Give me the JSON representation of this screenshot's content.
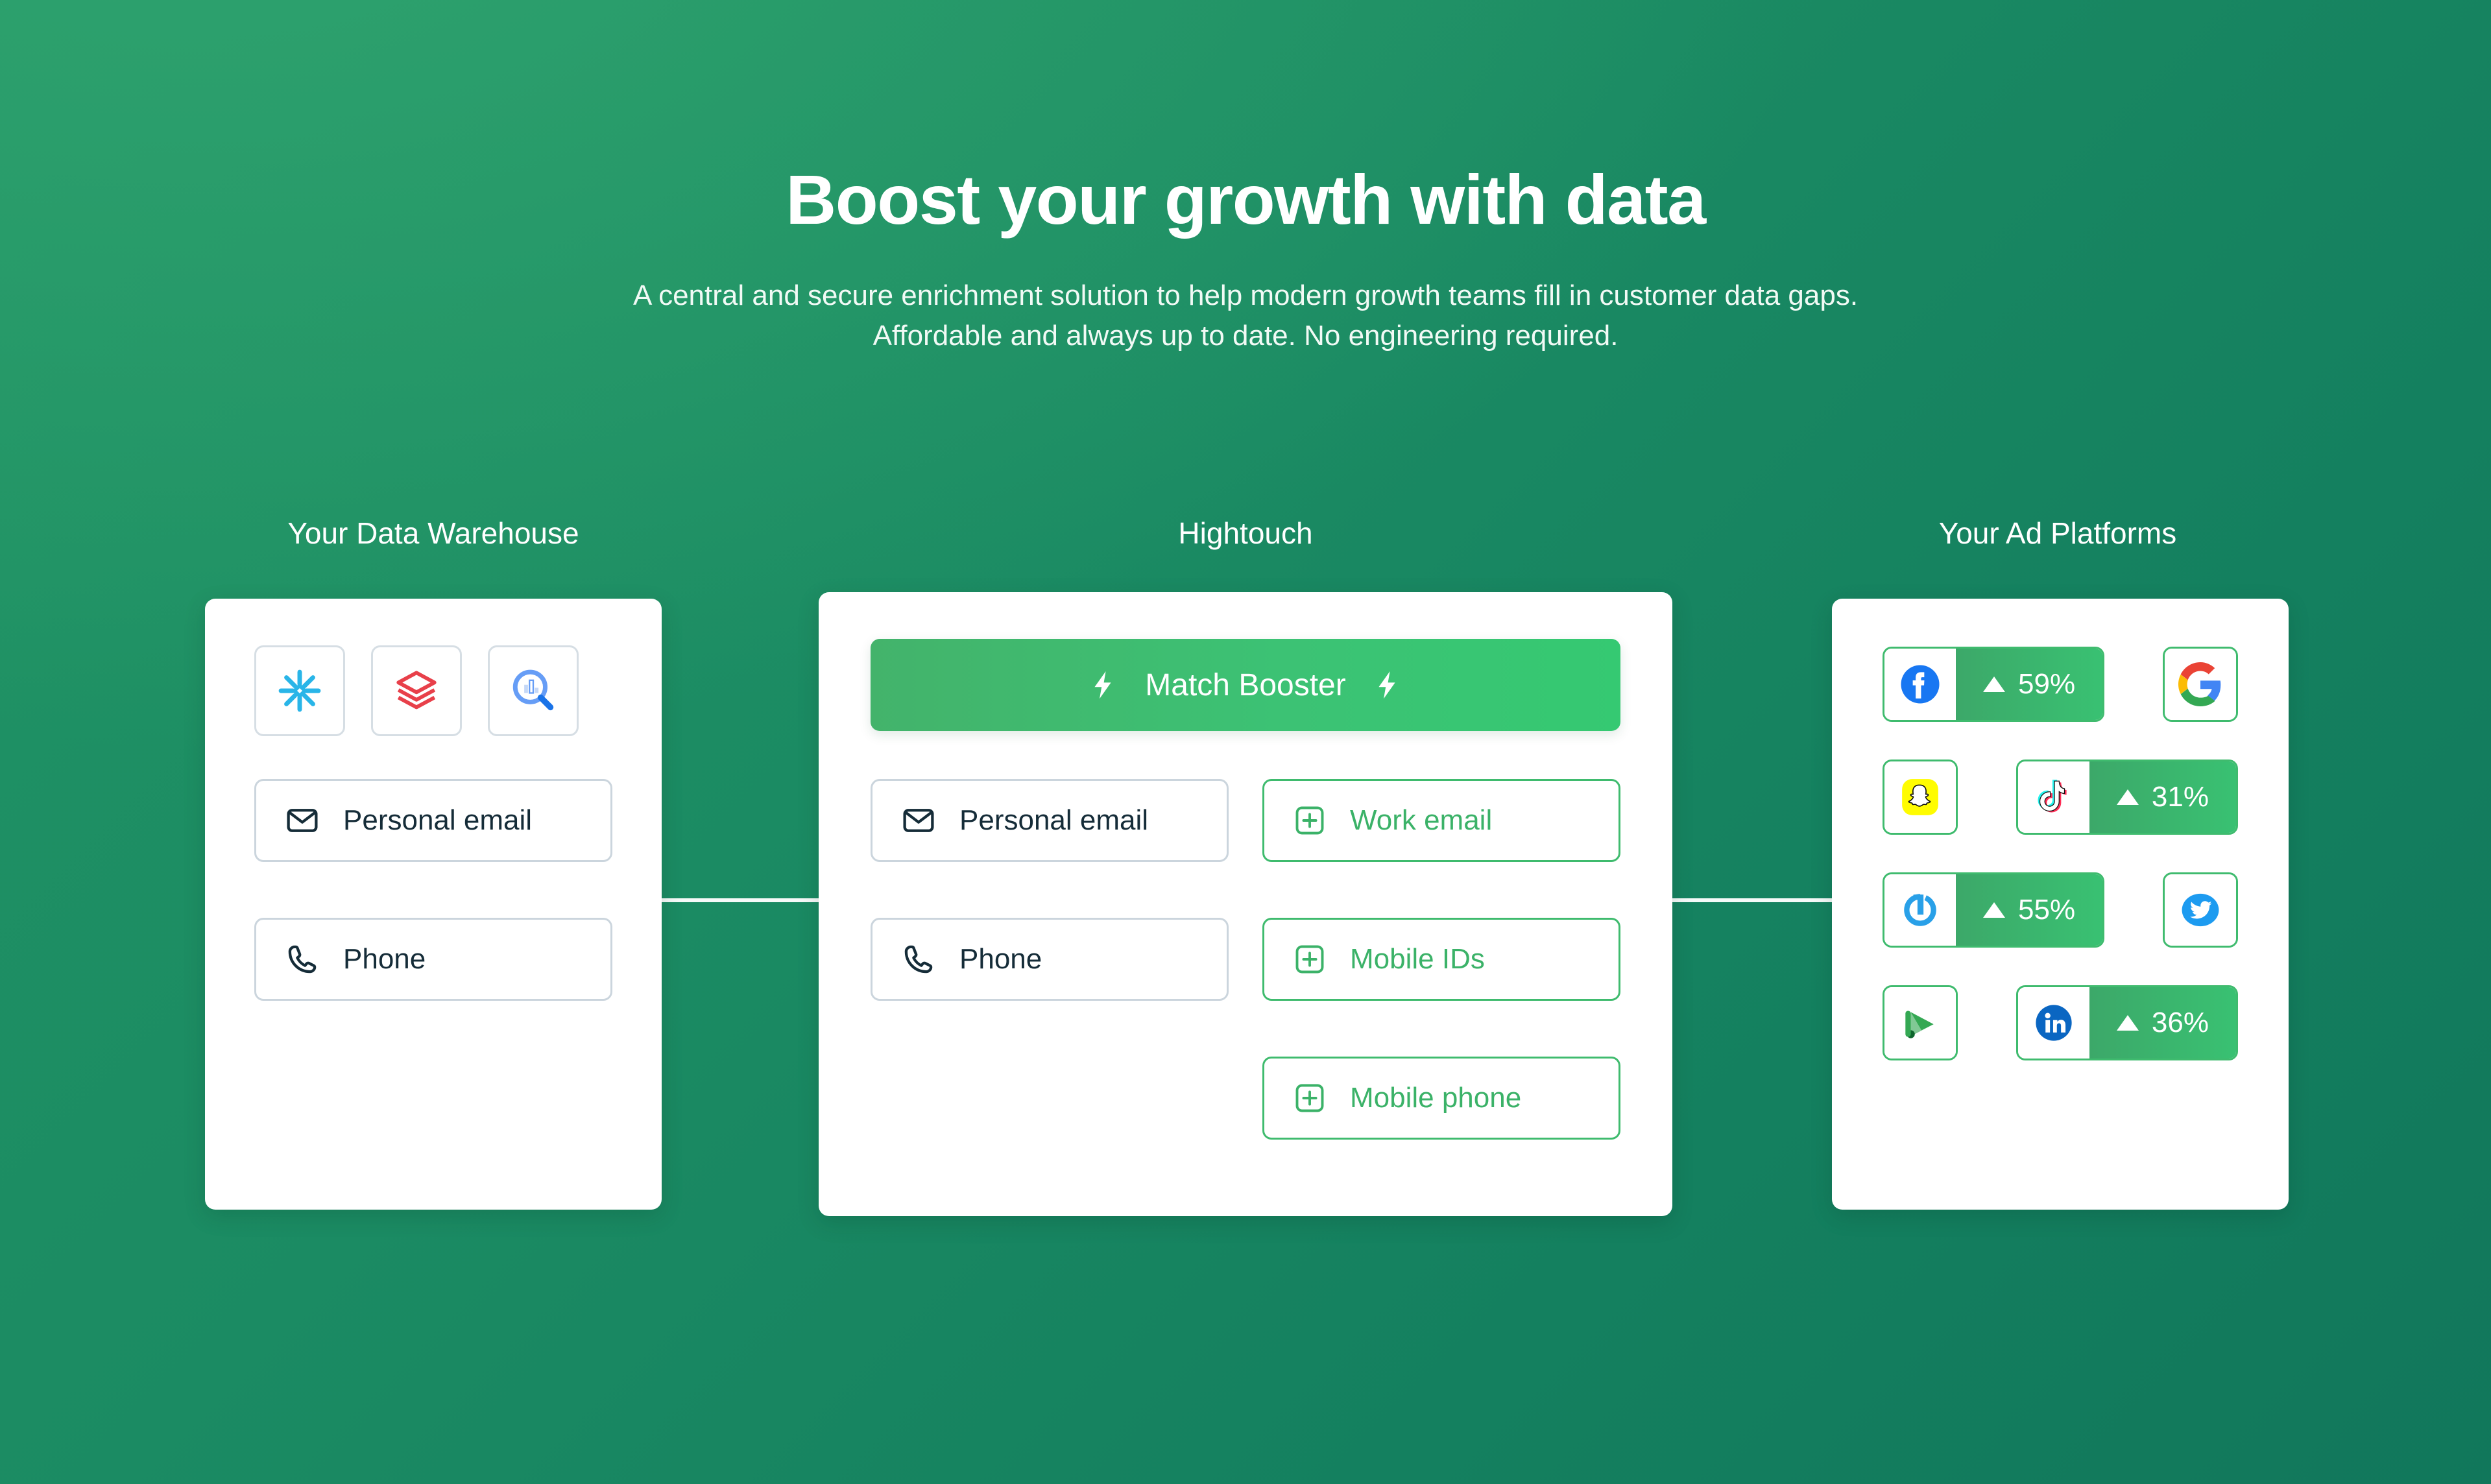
{
  "hero": {
    "title": "Boost your growth with data",
    "subtitle_line1": "A central and secure enrichment solution to help modern growth teams fill in customer data gaps.",
    "subtitle_line2": "Affordable and always up to date. No engineering required."
  },
  "colors": {
    "background_start": "#219464",
    "background_end": "#11775B",
    "accent_green": "#3FBB6E",
    "booster_gradient_start": "#43B36B",
    "booster_gradient_end": "#35C972",
    "field_border_grey": "#CBD5DD",
    "text_dark": "#152C38",
    "white": "#FFFFFF"
  },
  "columns": {
    "warehouse_label": "Your Data Warehouse",
    "hightouch_label": "Hightouch",
    "adplatforms_label": "Your Ad Platforms"
  },
  "warehouse": {
    "logos": [
      {
        "name": "snowflake-logo",
        "title": "Snowflake"
      },
      {
        "name": "databricks-logo",
        "title": "Databricks"
      },
      {
        "name": "bigquery-logo",
        "title": "BigQuery"
      }
    ],
    "fields": [
      {
        "icon": "envelope-icon",
        "label": "Personal email"
      },
      {
        "icon": "phone-icon",
        "label": "Phone"
      }
    ]
  },
  "hightouch": {
    "booster_label": "Match Booster",
    "booster_icon_left": "lightning-bolt-icon",
    "booster_icon_right": "lightning-bolt-icon",
    "existing_fields": [
      {
        "icon": "envelope-icon",
        "label": "Personal email"
      },
      {
        "icon": "phone-icon",
        "label": "Phone"
      }
    ],
    "enriched_fields": [
      {
        "icon": "plus-square-icon",
        "label": "Work email"
      },
      {
        "icon": "plus-square-icon",
        "label": "Mobile IDs"
      },
      {
        "icon": "plus-square-icon",
        "label": "Mobile phone"
      }
    ]
  },
  "ad_platforms": {
    "rows": [
      {
        "align": "left",
        "platform": "facebook-logo",
        "platform_title": "Facebook",
        "has_stat": true,
        "stat": "59%",
        "trend": "up"
      },
      {
        "align": "right",
        "platform": "google-logo",
        "platform_title": "Google",
        "has_stat": false,
        "stat": "",
        "trend": ""
      },
      {
        "align": "left",
        "platform": "snapchat-logo",
        "platform_title": "Snapchat",
        "has_stat": false,
        "stat": "",
        "trend": ""
      },
      {
        "align": "right",
        "platform": "tiktok-logo",
        "platform_title": "TikTok",
        "has_stat": true,
        "stat": "31%",
        "trend": "up"
      },
      {
        "align": "left",
        "platform": "tradedesk-logo",
        "platform_title": "The Trade Desk",
        "has_stat": true,
        "stat": "55%",
        "trend": "up"
      },
      {
        "align": "right",
        "platform": "twitter-logo",
        "platform_title": "Twitter",
        "has_stat": false,
        "stat": "",
        "trend": ""
      },
      {
        "align": "left",
        "platform": "display-video-360-logo",
        "platform_title": "Display & Video 360",
        "has_stat": false,
        "stat": "",
        "trend": ""
      },
      {
        "align": "right",
        "platform": "linkedin-logo",
        "platform_title": "LinkedIn",
        "has_stat": true,
        "stat": "36%",
        "trend": "up"
      }
    ]
  }
}
